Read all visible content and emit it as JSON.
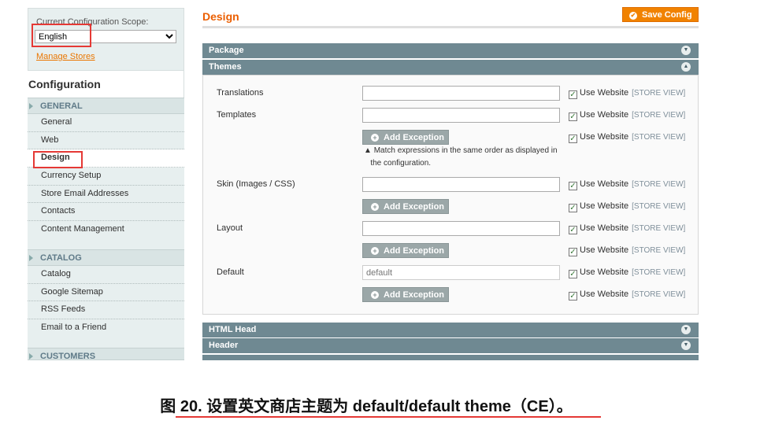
{
  "scope": {
    "label": "Current Configuration Scope:",
    "value": "English",
    "manage_link": "Manage Stores"
  },
  "sidebar": {
    "title": "Configuration",
    "sections": [
      {
        "label": "GENERAL",
        "items": [
          "General",
          "Web",
          "Design",
          "Currency Setup",
          "Store Email Addresses",
          "Contacts",
          "Content Management"
        ]
      },
      {
        "label": "CATALOG",
        "items": [
          "Catalog",
          "Google Sitemap",
          "RSS Feeds",
          "Email to a Friend"
        ]
      },
      {
        "label": "CUSTOMERS"
      }
    ],
    "active": "Design"
  },
  "main": {
    "title": "Design",
    "save_label": "Save Config",
    "sections": {
      "package": "Package",
      "themes": "Themes",
      "html_head": "HTML Head",
      "header": "Header"
    },
    "fields": [
      {
        "label": "Translations",
        "value": ""
      },
      {
        "label": "Templates",
        "value": ""
      },
      {
        "label": "Skin (Images / CSS)",
        "value": ""
      },
      {
        "label": "Layout",
        "value": ""
      },
      {
        "label": "Default",
        "value": "",
        "placeholder": "default"
      }
    ],
    "add_exception": "Add Exception",
    "note": [
      "Match expressions in the same order as displayed in",
      "the configuration."
    ],
    "use_website": "Use Website",
    "store_view": "[STORE VIEW]"
  },
  "caption": {
    "prefix": "图 20.",
    "text": "设置英文商店主题为 default/default theme（CE）。"
  },
  "colors": {
    "accent": "#eb5e00",
    "section_bar": "#6f8992",
    "highlight": "#e53935"
  }
}
